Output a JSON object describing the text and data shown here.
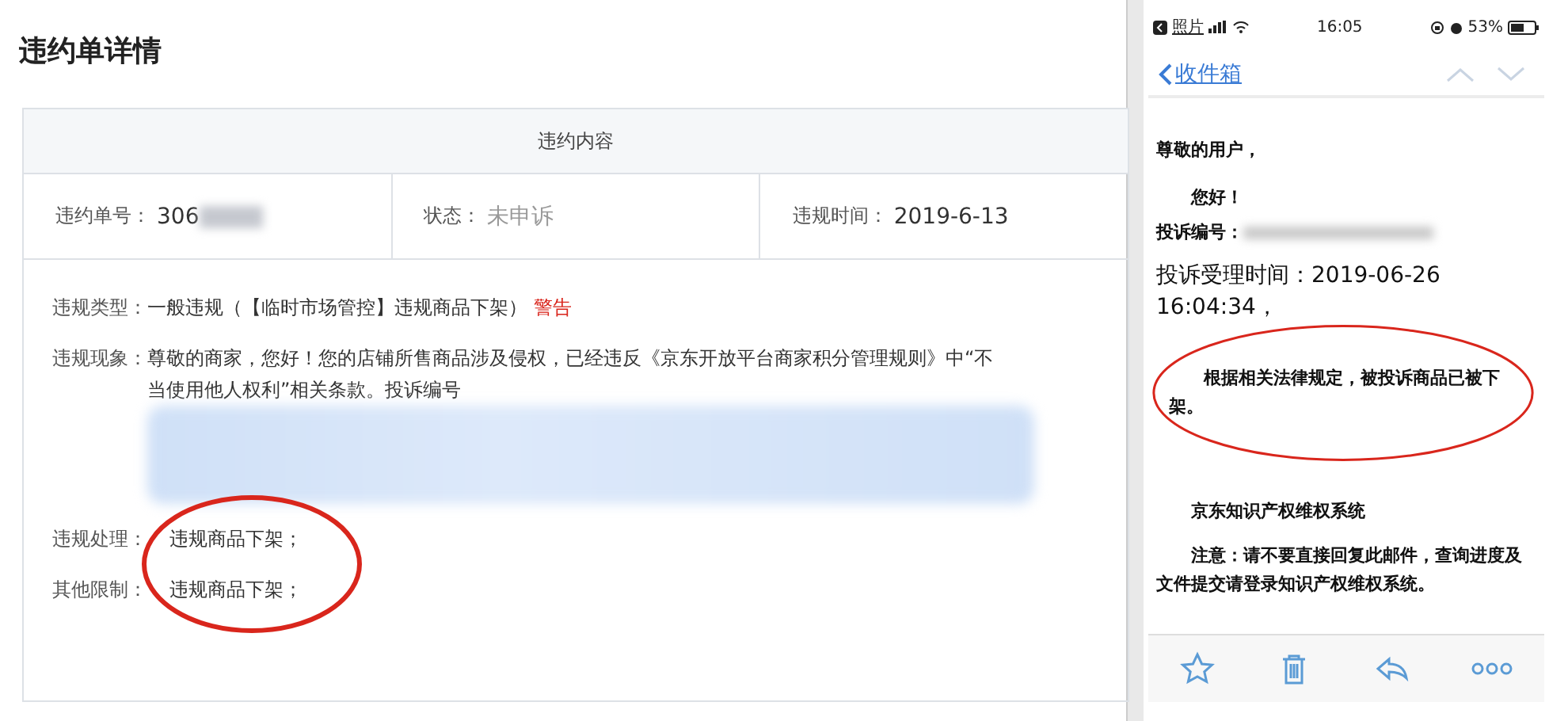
{
  "page_title": "违约单详情",
  "table": {
    "header": "违约内容",
    "summary": [
      {
        "label": "违约单号：",
        "value": "306",
        "kind": "redacted"
      },
      {
        "label": "状态：",
        "value": "未申诉",
        "kind": "muted"
      },
      {
        "label": "违规时间：",
        "value": "2019-6-13",
        "kind": "plain"
      }
    ],
    "violation_type": {
      "label": "违规类型：",
      "value": "一般违规（【临时市场管控】违规商品下架）",
      "tag": "警告"
    },
    "phenomenon": {
      "label": "违规现象：",
      "text": "尊敬的商家，您好！您的店铺所售商品涉及侵权，已经违反《京东开放平台商家积分管理规则》中“不当使用他人权利”相关条款。投诉编号"
    },
    "details": [
      {
        "label": "违规处理：",
        "value": "违规商品下架；"
      },
      {
        "label": "其他限制：",
        "value": "违规商品下架；"
      }
    ]
  },
  "phone": {
    "status_bar": {
      "back_app": "照片",
      "time": "16:05",
      "battery": "53%"
    },
    "nav": {
      "back": "收件箱"
    },
    "email": {
      "greeting": "尊敬的用户，",
      "hello": "您好！",
      "complaint_no_label": "投诉编号：",
      "accept_time": "投诉受理时间：2019-06-26 16:04:34，",
      "result": "根据相关法律规定，被投诉商品已被下架。",
      "signature": "京东知识产权维权系统",
      "notice": "注意：请不要直接回复此邮件，查询进度及文件提交请登录知识产权维权系统。"
    }
  }
}
